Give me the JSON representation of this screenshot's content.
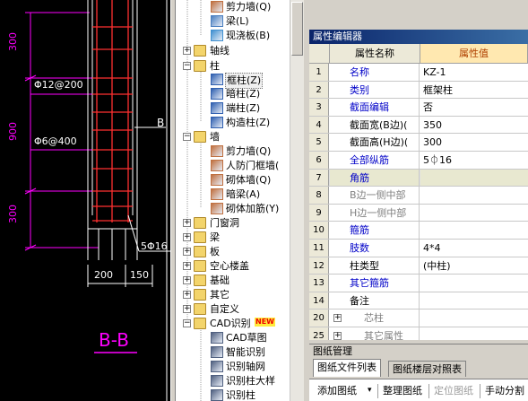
{
  "cad": {
    "dims_left": [
      "300",
      "900",
      "300"
    ],
    "rebar_labels": [
      "Φ12@200",
      "Φ6@400"
    ],
    "side_label": "B",
    "main_bar": "5Φ16",
    "dims_bottom": [
      "200",
      "150"
    ],
    "section_label": "B-B"
  },
  "tree": {
    "items": [
      {
        "label": "剪力墙(Q)"
      },
      {
        "label": "梁(L)"
      },
      {
        "label": "现浇板(B)"
      },
      {
        "label": "轴线",
        "toggle": "+"
      },
      {
        "label": "柱",
        "toggle": "-"
      },
      {
        "label": "框柱(Z)"
      },
      {
        "label": "暗柱(Z)"
      },
      {
        "label": "端柱(Z)"
      },
      {
        "label": "构造柱(Z)"
      },
      {
        "label": "墙",
        "toggle": "-"
      },
      {
        "label": "剪力墙(Q)"
      },
      {
        "label": "人防门框墙("
      },
      {
        "label": "砌体墙(Q)"
      },
      {
        "label": "暗梁(A)"
      },
      {
        "label": "砌体加筋(Y)"
      },
      {
        "label": "门窗洞",
        "toggle": "+"
      },
      {
        "label": "梁",
        "toggle": "+"
      },
      {
        "label": "板",
        "toggle": "+"
      },
      {
        "label": "空心楼盖",
        "toggle": "+"
      },
      {
        "label": "基础",
        "toggle": "+"
      },
      {
        "label": "其它",
        "toggle": "+"
      },
      {
        "label": "自定义",
        "toggle": "+"
      },
      {
        "label": "CAD识别",
        "toggle": "-",
        "badge": "NEW"
      },
      {
        "label": "CAD草图"
      },
      {
        "label": "智能识别"
      },
      {
        "label": "识别轴网"
      },
      {
        "label": "识别柱大样"
      },
      {
        "label": "识别柱"
      }
    ]
  },
  "props": {
    "panel_title": "属性编辑器",
    "col_name": "属性名称",
    "col_value": "属性值",
    "rows": [
      {
        "n": "1",
        "name": "名称",
        "value": "KZ-1",
        "style": "blue"
      },
      {
        "n": "2",
        "name": "类别",
        "value": "框架柱",
        "style": "blue"
      },
      {
        "n": "3",
        "name": "截面编辑",
        "value": "否",
        "style": "blue"
      },
      {
        "n": "4",
        "name": "截面宽(B边)(",
        "value": "350",
        "style": "black"
      },
      {
        "n": "5",
        "name": "截面高(H边)(",
        "value": "300",
        "style": "black"
      },
      {
        "n": "6",
        "name": "全部纵筋",
        "value": "5⏀16",
        "style": "blue"
      },
      {
        "n": "7",
        "name": "角筋",
        "value": "",
        "style": "blue"
      },
      {
        "n": "8",
        "name": "B边一侧中部",
        "value": "",
        "style": "gray"
      },
      {
        "n": "9",
        "name": "H边一侧中部",
        "value": "",
        "style": "gray"
      },
      {
        "n": "10",
        "name": "箍筋",
        "value": "",
        "style": "blue"
      },
      {
        "n": "11",
        "name": "肢数",
        "value": "4*4",
        "style": "blue"
      },
      {
        "n": "12",
        "name": "柱类型",
        "value": "(中柱)",
        "style": "black"
      },
      {
        "n": "13",
        "name": "其它箍筋",
        "value": "",
        "style": "blue"
      },
      {
        "n": "14",
        "name": "备注",
        "value": "",
        "style": "black"
      },
      {
        "n": "20",
        "name": "芯柱",
        "value": "",
        "style": "gray",
        "expander": "+"
      },
      {
        "n": "25",
        "name": "其它属性",
        "value": "",
        "style": "gray",
        "expander": "+"
      }
    ]
  },
  "drawing": {
    "title": "图纸管理",
    "tabs": [
      "图纸文件列表",
      "图纸楼层对照表"
    ],
    "toolbar": [
      "添加图纸",
      "▾",
      "整理图纸",
      "定位图纸",
      "手动分割"
    ]
  },
  "colors": {
    "cad_bg": "#000000",
    "cad_magenta": "#ff00ff",
    "cad_red": "#ff3030",
    "cad_white": "#ffffff",
    "title_bar": "#0a246a",
    "selected_row": "#e8e8d0",
    "prop_value_header": "#ffe8b0"
  }
}
